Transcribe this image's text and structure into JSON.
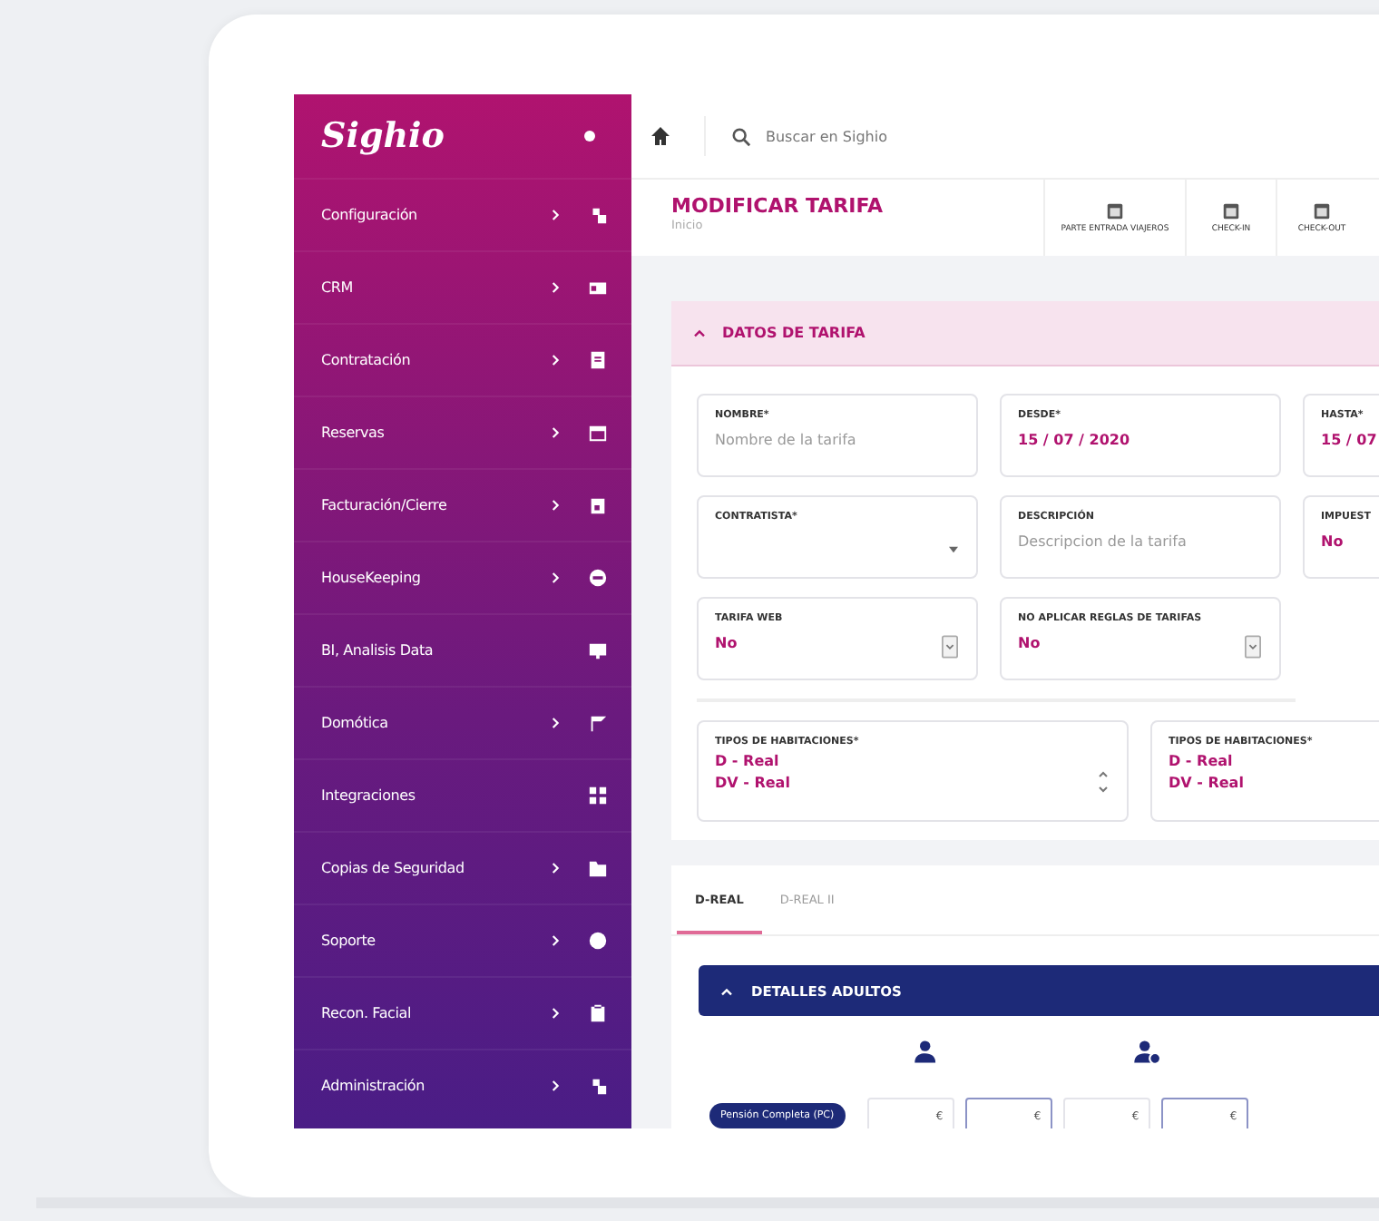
{
  "sidebar": {
    "logo": "Sighio",
    "items": [
      {
        "label": "Configuración",
        "arrow": true
      },
      {
        "label": "CRM",
        "arrow": true
      },
      {
        "label": "Contratación",
        "arrow": true
      },
      {
        "label": "Reservas",
        "arrow": true
      },
      {
        "label": "Facturación/Cierre",
        "arrow": true
      },
      {
        "label": "HouseKeeping",
        "arrow": true
      },
      {
        "label": "BI, Analisis Data",
        "arrow": false
      },
      {
        "label": "Domótica",
        "arrow": true
      },
      {
        "label": "Integraciones",
        "arrow": false
      },
      {
        "label": "Copias de Seguridad",
        "arrow": true
      },
      {
        "label": "Soporte",
        "arrow": true
      },
      {
        "label": "Recon. Facial",
        "arrow": true
      },
      {
        "label": "Administración",
        "arrow": true
      }
    ]
  },
  "topbar": {
    "search": {
      "placeholder": "Buscar en Sighio"
    }
  },
  "header": {
    "title": "MODIFICAR TARIFA",
    "breadcrumb": "Inicio",
    "actions": [
      {
        "label": "PARTE ENTRADA VIAJEROS"
      },
      {
        "label": "CHECK-IN"
      },
      {
        "label": "CHECK-OUT"
      }
    ]
  },
  "panel": {
    "title": "DATOS DE TARIFA",
    "field_rows": [
      [
        {
          "label": "NOMBRE*",
          "placeholder": "Nombre de la tarifa",
          "kind": "text"
        },
        {
          "label": "DESDE*",
          "value": "15 / 07 / 2020",
          "kind": "text"
        },
        {
          "label": "HASTA*",
          "value": "15 / 07",
          "kind": "text"
        }
      ],
      [
        {
          "label": "CONTRATISTA*",
          "kind": "dropdown"
        },
        {
          "label": "DESCRIPCIÓN",
          "placeholder": "Descripcion de la tarifa",
          "kind": "text"
        },
        {
          "label": "IMPUEST",
          "value": "No",
          "kind": "text"
        }
      ],
      [
        {
          "label": "TARIFA WEB",
          "value": "No",
          "kind": "select"
        },
        {
          "label": "NO APLICAR REGLAS DE TARIFAS",
          "value": "No",
          "kind": "select"
        }
      ]
    ],
    "room_types": [
      {
        "label": "TIPOS DE HABITACIONES*",
        "options": [
          "D - Real",
          "DV - Real"
        ],
        "spinner": true
      },
      {
        "label": "TIPOS DE HABITACIONES*",
        "options": [
          "D - Real",
          "DV - Real"
        ]
      }
    ]
  },
  "tabs": [
    {
      "label": "D-REAL",
      "selected": true
    },
    {
      "label": "D-REAL II",
      "selected": false
    }
  ],
  "adults": {
    "title": "DETALLES ADULTOS",
    "columns": [
      {
        "kind": "person"
      },
      {
        "kind": "person-info"
      }
    ],
    "rows": [
      {
        "label": "Pensión Completa (PC)",
        "currency": [
          "€",
          "€",
          "€",
          "€"
        ]
      }
    ]
  }
}
